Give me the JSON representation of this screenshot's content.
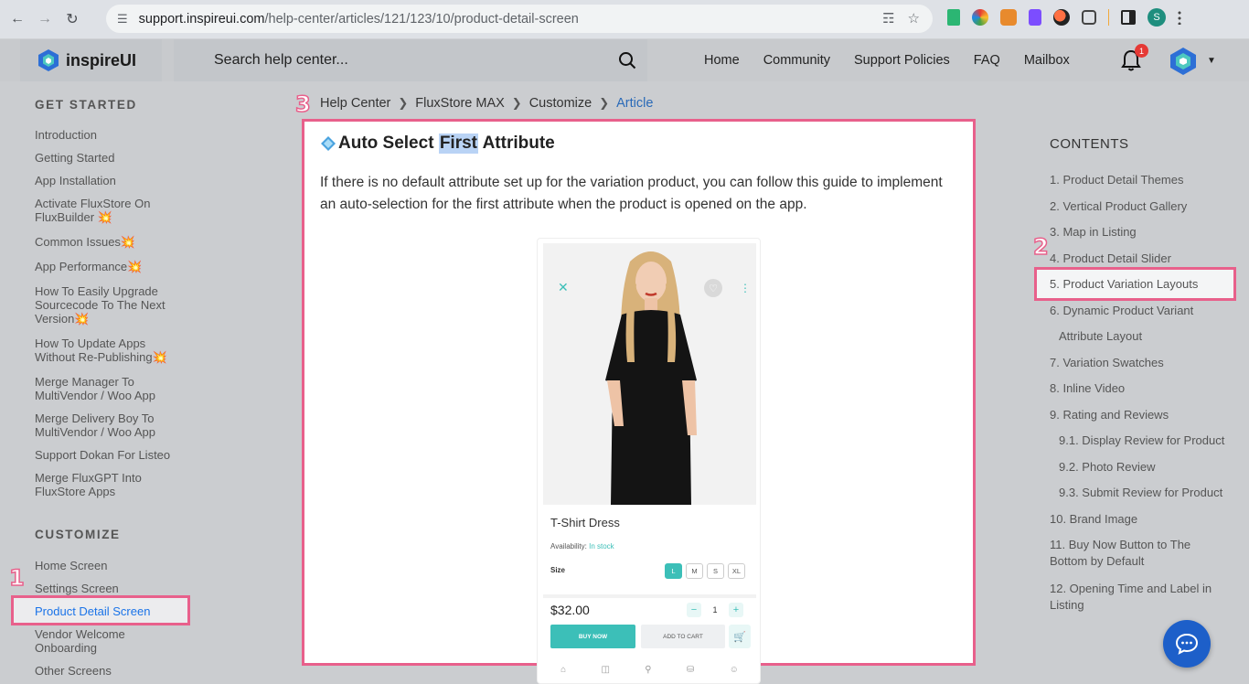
{
  "browser": {
    "url_host": "support.inspireui.com",
    "url_path": "/help-center/articles/121/123/10/product-detail-screen",
    "profile_initial": "S"
  },
  "header": {
    "logo_text": "inspireUI",
    "search_placeholder": "Search help center...",
    "nav": [
      "Home",
      "Community",
      "Support Policies",
      "FAQ",
      "Mailbox"
    ],
    "notification_count": "1"
  },
  "sidebar": {
    "sections": [
      {
        "title": "GET STARTED",
        "items": [
          {
            "label": "Introduction"
          },
          {
            "label": "Getting Started"
          },
          {
            "label": "App Installation"
          },
          {
            "label": "Activate FluxStore On FluxBuilder 💥"
          },
          {
            "label": "Common Issues💥"
          },
          {
            "label": "App Performance💥"
          },
          {
            "label": "How To Easily Upgrade Sourcecode To The Next Version💥"
          },
          {
            "label": "How To Update Apps Without Re-Publishing💥"
          },
          {
            "label": "Merge Manager To MultiVendor / Woo App"
          },
          {
            "label": "Merge Delivery Boy To MultiVendor / Woo App"
          },
          {
            "label": "Support Dokan For Listeo"
          },
          {
            "label": "Merge FluxGPT Into FluxStore Apps"
          }
        ]
      },
      {
        "title": "CUSTOMIZE",
        "items": [
          {
            "label": "Home Screen"
          },
          {
            "label": "Settings Screen"
          },
          {
            "label": "Product Detail Screen",
            "active": true
          },
          {
            "label": "Vendor Welcome Onboarding"
          },
          {
            "label": "Other Screens"
          }
        ]
      }
    ]
  },
  "breadcrumb": [
    "Help Center",
    "FluxStore MAX",
    "Customize",
    "Article"
  ],
  "article": {
    "title_before": "Auto Select ",
    "title_highlight": "First",
    "title_after": " Attribute",
    "body": "If there is no default attribute set up for the variation product, you can follow this guide to implement an auto-selection for the first attribute when the product is opened on the app."
  },
  "product_preview": {
    "name": "T-Shirt Dress",
    "availability_label": "Availability:",
    "availability_value": "In stock",
    "size_label": "Size",
    "sizes": [
      "L",
      "M",
      "S",
      "XL"
    ],
    "selected_size": "L",
    "price": "$32.00",
    "quantity": "1",
    "buy_now": "BUY NOW",
    "add_to_cart": "ADD TO CART"
  },
  "toc": {
    "title": "CONTENTS",
    "items": [
      {
        "label": "1. Product Detail Themes"
      },
      {
        "label": "2. Vertical Product Gallery"
      },
      {
        "label": "3. Map in Listing"
      },
      {
        "label": "4. Product Detail Slider"
      },
      {
        "label": "5. Product Variation Layouts",
        "active": true
      },
      {
        "label": "6. Dynamic Product Variant"
      },
      {
        "label": "Attribute Layout"
      },
      {
        "label": "7. Variation Swatches"
      },
      {
        "label": "8. Inline Video"
      },
      {
        "label": "9. Rating and Reviews"
      },
      {
        "label": "9.1. Display Review for Product"
      },
      {
        "label": "9.2. Photo Review"
      },
      {
        "label": "9.3. Submit Review for Product"
      },
      {
        "label": "10. Brand Image"
      },
      {
        "label": "11. Buy Now Button to The Bottom by Default"
      },
      {
        "label": "12. Opening Time and Label in Listing"
      }
    ]
  },
  "annotations": [
    "1",
    "2",
    "3"
  ],
  "colors": {
    "accent": "#1a73e8",
    "annotation": "#e8608b",
    "product_teal": "#3cbfb8",
    "chat_button": "#1d5fc9"
  }
}
